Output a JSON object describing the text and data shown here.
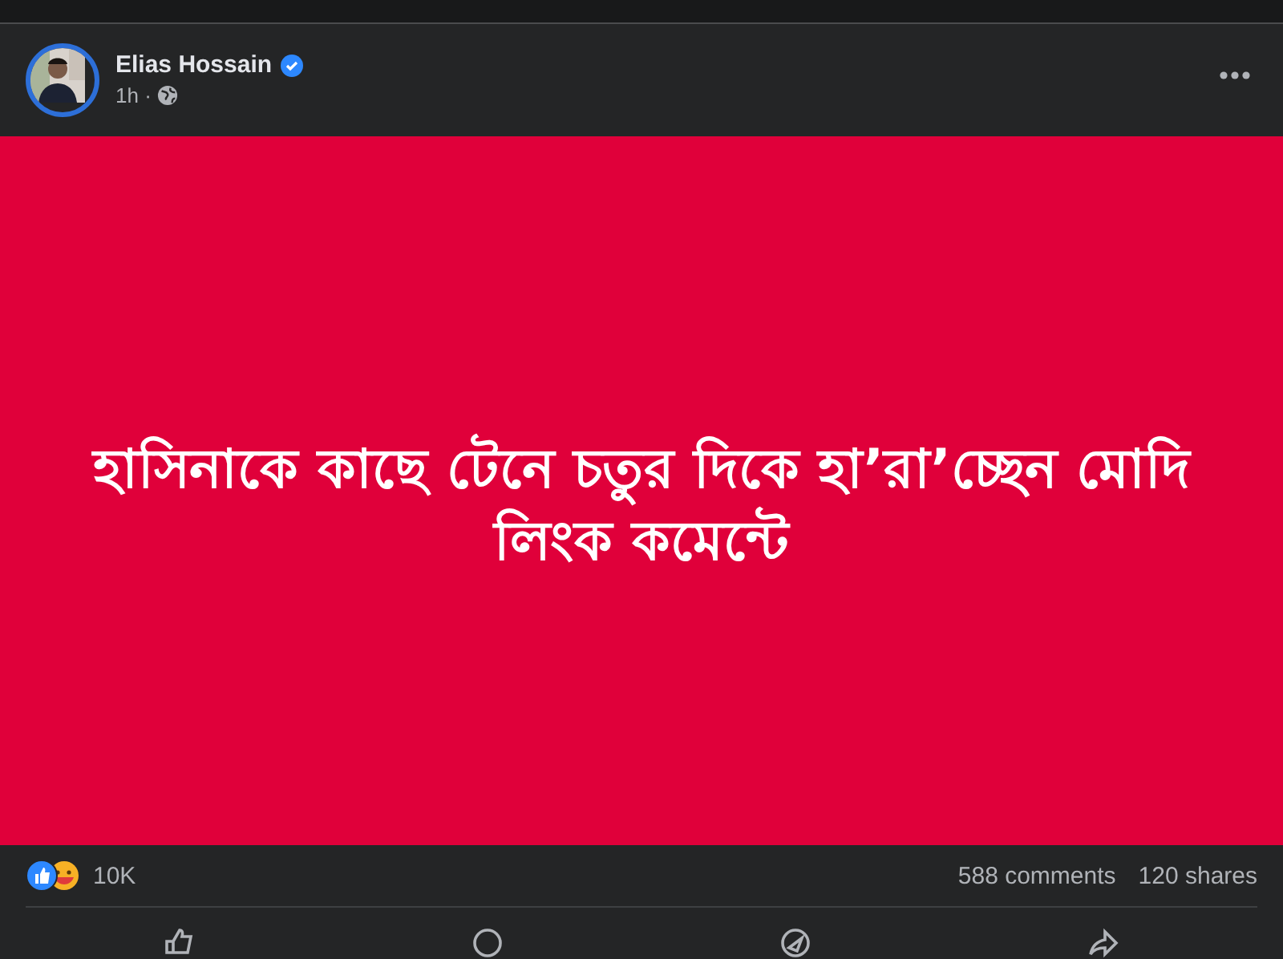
{
  "post": {
    "author": "Elias Hossain",
    "verified": true,
    "time": "1h ·",
    "text_lines": [
      "হাসিনাকে কাছে টেনে চতুর দিকে হা’রা’চ্ছেন মোদি",
      "লিংক কমেন্টে"
    ]
  },
  "stats": {
    "reactions": "10K",
    "comments": "588 comments",
    "shares": "120 shares"
  },
  "actions": [
    {
      "kind": "like"
    },
    {
      "kind": "comment"
    },
    {
      "kind": "send"
    },
    {
      "kind": "share"
    }
  ]
}
